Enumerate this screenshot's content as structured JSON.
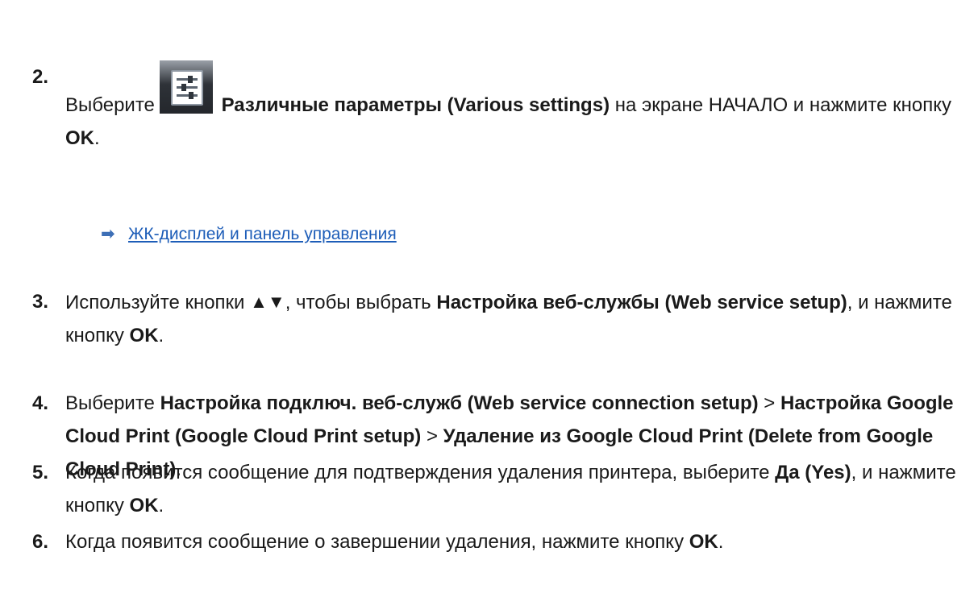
{
  "steps": [
    {
      "num": "2.",
      "pre": "Выберите",
      "bold1": "Различные параметры (Various settings)",
      "mid": "на экране НАЧАЛО и нажмите кнопку",
      "bold2": "OK",
      "end": "."
    },
    {
      "num": "3.",
      "pre": "Используйте кнопки",
      "arrows": "▲▼",
      "mid": ", чтобы выбрать",
      "bold1": "Настройка веб-службы (Web service setup)",
      "mid2": ", и нажмите кнопку",
      "bold2": "OK",
      "end": "."
    },
    {
      "num": "4.",
      "pre": "Выберите",
      "bold1": "Настройка подключ. веб-служб (Web service connection setup)",
      "sep1": ">",
      "bold2": "Настройка Google Cloud Print (Google Cloud Print setup)",
      "sep2": ">",
      "bold3": "Удаление из Google Cloud Print (Delete from Google Cloud Print)",
      "end": "."
    },
    {
      "num": "5.",
      "pre": "Когда появится сообщение для подтверждения удаления принтера, выберите",
      "bold1": "Да (Yes)",
      "mid": ", и нажмите кнопку",
      "bold2": "OK",
      "end": "."
    },
    {
      "num": "6.",
      "pre": "Когда появится сообщение о завершении удаления, нажмите кнопку",
      "bold1": "OK",
      "end": "."
    }
  ],
  "link": {
    "arrow": "➡",
    "text": "ЖК-дисплей и панель управления"
  },
  "icons": {
    "settings": "various-settings-icon"
  }
}
